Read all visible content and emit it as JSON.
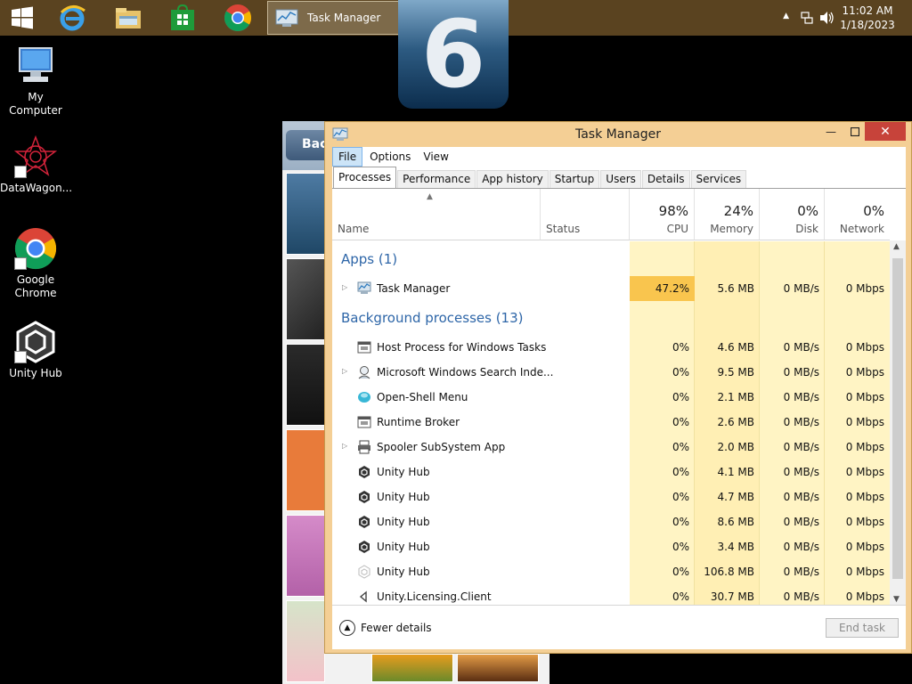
{
  "taskbar": {
    "active_window_label": "Task Manager",
    "clock_time": "11:02 AM",
    "clock_date": "1/18/2023"
  },
  "desktop": {
    "icons": [
      {
        "label": "My Computer"
      },
      {
        "label": "DataWagon..."
      },
      {
        "label": "Google Chrome"
      },
      {
        "label": "Unity Hub"
      }
    ]
  },
  "photo_app": {
    "back_label": "Bac"
  },
  "ios_badge": {
    "text": "6"
  },
  "task_manager": {
    "title": "Task Manager",
    "menu": [
      "File",
      "Options",
      "View"
    ],
    "tabs": [
      "Processes",
      "Performance",
      "App history",
      "Startup",
      "Users",
      "Details",
      "Services"
    ],
    "columns": {
      "name": "Name",
      "status": "Status",
      "cpu": {
        "pct": "98%",
        "label": "CPU"
      },
      "memory": {
        "pct": "24%",
        "label": "Memory"
      },
      "disk": {
        "pct": "0%",
        "label": "Disk"
      },
      "network": {
        "pct": "0%",
        "label": "Network"
      }
    },
    "groups": {
      "apps": "Apps (1)",
      "background": "Background processes (13)"
    },
    "apps": [
      {
        "name": "Task Manager",
        "cpu": "47.2%",
        "memory": "5.6 MB",
        "disk": "0 MB/s",
        "network": "0 Mbps"
      }
    ],
    "background": [
      {
        "name": "Host Process for Windows Tasks",
        "cpu": "0%",
        "memory": "4.6 MB",
        "disk": "0 MB/s",
        "network": "0 Mbps"
      },
      {
        "name": "Microsoft Windows Search Inde...",
        "cpu": "0%",
        "memory": "9.5 MB",
        "disk": "0 MB/s",
        "network": "0 Mbps"
      },
      {
        "name": "Open-Shell Menu",
        "cpu": "0%",
        "memory": "2.1 MB",
        "disk": "0 MB/s",
        "network": "0 Mbps"
      },
      {
        "name": "Runtime Broker",
        "cpu": "0%",
        "memory": "2.6 MB",
        "disk": "0 MB/s",
        "network": "0 Mbps"
      },
      {
        "name": "Spooler SubSystem App",
        "cpu": "0%",
        "memory": "2.0 MB",
        "disk": "0 MB/s",
        "network": "0 Mbps"
      },
      {
        "name": "Unity Hub",
        "cpu": "0%",
        "memory": "4.1 MB",
        "disk": "0 MB/s",
        "network": "0 Mbps"
      },
      {
        "name": "Unity Hub",
        "cpu": "0%",
        "memory": "4.7 MB",
        "disk": "0 MB/s",
        "network": "0 Mbps"
      },
      {
        "name": "Unity Hub",
        "cpu": "0%",
        "memory": "8.6 MB",
        "disk": "0 MB/s",
        "network": "0 Mbps"
      },
      {
        "name": "Unity Hub",
        "cpu": "0%",
        "memory": "3.4 MB",
        "disk": "0 MB/s",
        "network": "0 Mbps"
      },
      {
        "name": "Unity Hub",
        "cpu": "0%",
        "memory": "106.8 MB",
        "disk": "0 MB/s",
        "network": "0 Mbps"
      },
      {
        "name": "Unity.Licensing.Client",
        "cpu": "0%",
        "memory": "30.7 MB",
        "disk": "0 MB/s",
        "network": "0 Mbps"
      }
    ],
    "footer": {
      "fewer_details": "Fewer details",
      "end_task": "End task"
    }
  }
}
